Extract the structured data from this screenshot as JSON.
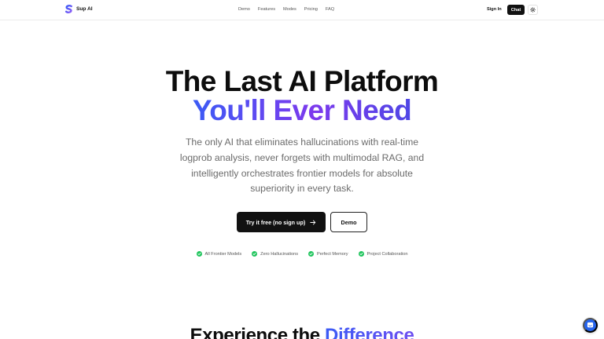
{
  "header": {
    "brand": "Sup AI",
    "nav": [
      "Demo",
      "Features",
      "Modes",
      "Pricing",
      "FAQ"
    ],
    "sign_in": "Sign In",
    "chat": "Chat"
  },
  "hero": {
    "title_line1": "The Last AI Platform",
    "title_line2": "You'll Ever Need",
    "subtitle": "The only AI that eliminates hallucinations with real-time logprob analysis, never forgets with multimodal RAG, and intelligently orchestrates frontier models for absolute superiority in every task.",
    "cta_primary": "Try it free (no sign up)",
    "cta_secondary": "Demo",
    "features": [
      "All Frontier Models",
      "Zero Hallucinations",
      "Perfect Memory",
      "Project Collaboration"
    ]
  },
  "section": {
    "title_start": "Experience the ",
    "title_highlight": "Difference"
  },
  "colors": {
    "accent_blue": "#3b5bf5",
    "accent_purple": "#7c3aed",
    "check_green": "#22c55e",
    "support_blue": "#2563eb"
  }
}
